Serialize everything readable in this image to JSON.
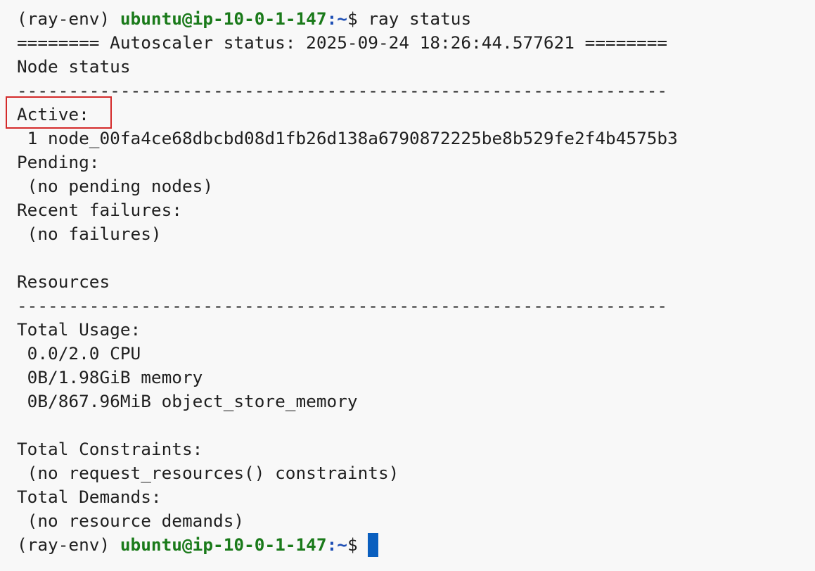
{
  "prompt": {
    "env": "(ray-env) ",
    "user_host": "ubuntu@ip-10-0-1-147",
    "path": ":~",
    "symbol": "$ "
  },
  "command": "ray status",
  "output": {
    "autoscaler_header": "======== Autoscaler status: 2025-09-24 18:26:44.577621 ========",
    "node_status_title": "Node status",
    "divider": "---------------------------------------------------------------",
    "active_label": "Active:",
    "active_node": " 1 node_00fa4ce68dbcbd08d1fb26d138a6790872225be8b529fe2f4b4575b3",
    "pending_label": "Pending:",
    "pending_value": " (no pending nodes)",
    "failures_label": "Recent failures:",
    "failures_value": " (no failures)",
    "resources_title": "Resources",
    "total_usage_label": "Total Usage:",
    "usage_cpu": " 0.0/2.0 CPU",
    "usage_memory": " 0B/1.98GiB memory",
    "usage_object_store": " 0B/867.96MiB object_store_memory",
    "constraints_label": "Total Constraints:",
    "constraints_value": " (no request_resources() constraints)",
    "demands_label": "Total Demands:",
    "demands_value": " (no resource demands)"
  },
  "colors": {
    "user_host": "#1a7a1a",
    "path": "#1e4fb5",
    "cursor": "#0a5fbf",
    "highlight_box": "#d42a2a"
  }
}
